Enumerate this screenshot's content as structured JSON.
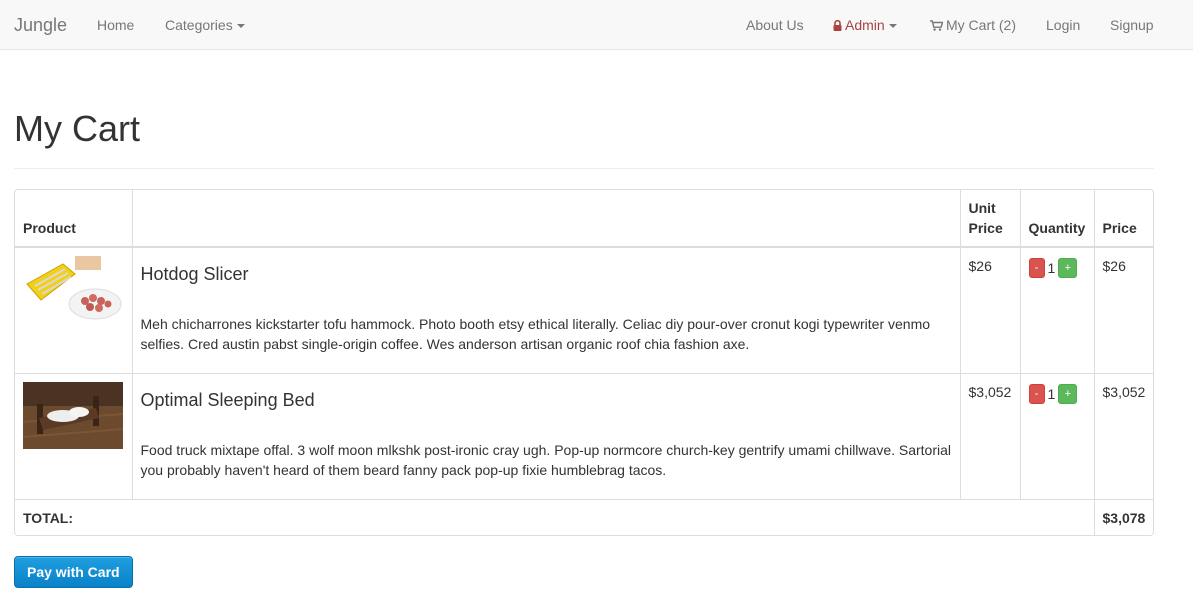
{
  "navbar": {
    "brand": "Jungle",
    "home": "Home",
    "categories": "Categories",
    "about": "About Us",
    "admin": "Admin",
    "cart": "My Cart (2)",
    "login": "Login",
    "signup": "Signup"
  },
  "page": {
    "title": "My Cart"
  },
  "table": {
    "headers": {
      "product": "Product",
      "unit_price": "Unit Price",
      "quantity": "Quantity",
      "price": "Price"
    },
    "rows": [
      {
        "name": "Hotdog Slicer",
        "description": "Meh chicharrones kickstarter tofu hammock. Photo booth etsy ethical literally. Celiac diy pour-over cronut kogi typewriter venmo selfies. Cred austin pabst single-origin coffee. Wes anderson artisan organic roof chia fashion axe.",
        "unit_price": "$26",
        "quantity": "1",
        "price": "$26"
      },
      {
        "name": "Optimal Sleeping Bed",
        "description": "Food truck mixtape offal. 3 wolf moon mlkshk post-ironic cray ugh. Pop-up normcore church-key gentrify umami chillwave. Sartorial you probably haven't heard of them beard fanny pack pop-up fixie humblebrag tacos.",
        "unit_price": "$3,052",
        "quantity": "1",
        "price": "$3,052"
      }
    ],
    "qty_minus": "-",
    "qty_plus": "+",
    "total_label": "TOTAL:",
    "total_value": "$3,078"
  },
  "actions": {
    "pay": "Pay with Card"
  },
  "colors": {
    "danger": "#d9534f",
    "success": "#5cb85c",
    "pay_button": "#1392d8",
    "admin_text": "#a94442"
  }
}
